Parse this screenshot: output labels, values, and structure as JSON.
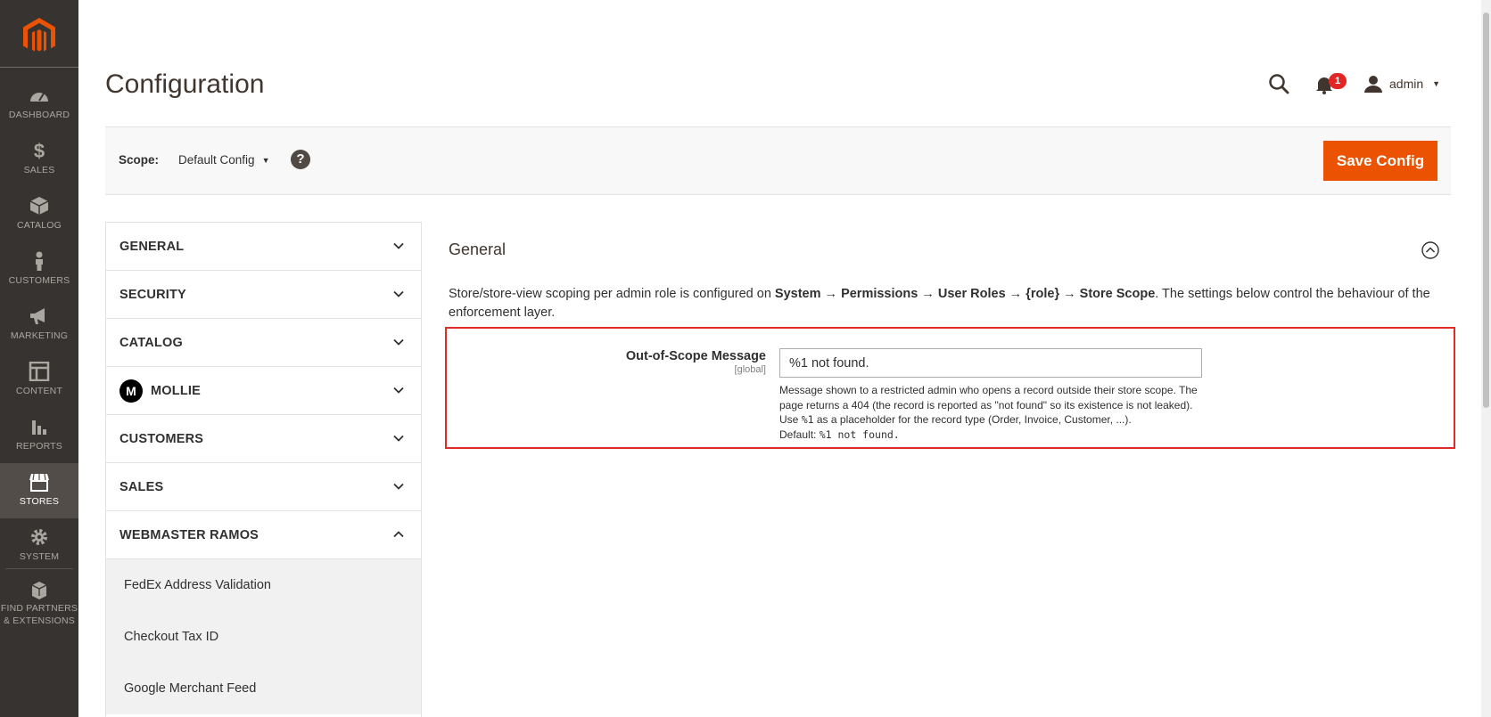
{
  "nav": {
    "items": [
      {
        "label": "DASHBOARD",
        "icon": "dashboard-icon"
      },
      {
        "label": "SALES",
        "icon": "dollar-icon"
      },
      {
        "label": "CATALOG",
        "icon": "box-icon"
      },
      {
        "label": "CUSTOMERS",
        "icon": "person-icon"
      },
      {
        "label": "MARKETING",
        "icon": "megaphone-icon"
      },
      {
        "label": "CONTENT",
        "icon": "layout-icon"
      },
      {
        "label": "REPORTS",
        "icon": "bar-chart-icon"
      },
      {
        "label": "STORES",
        "icon": "store-icon"
      },
      {
        "label": "SYSTEM",
        "icon": "gear-icon"
      },
      {
        "label_line1": "FIND PARTNERS",
        "label_line2": "& EXTENSIONS",
        "icon": "cubes-icon"
      }
    ],
    "active": "STORES"
  },
  "header": {
    "title": "Configuration",
    "notification_count": "1",
    "user": "admin"
  },
  "scope": {
    "label": "Scope:",
    "value": "Default Config",
    "help": "?",
    "save_label": "Save Config"
  },
  "tabs": {
    "items": [
      {
        "label": "GENERAL"
      },
      {
        "label": "SECURITY"
      },
      {
        "label": "CATALOG"
      },
      {
        "label": "MOLLIE"
      },
      {
        "label": "CUSTOMERS"
      },
      {
        "label": "SALES"
      },
      {
        "label": "WEBMASTER RAMOS"
      }
    ],
    "sub_items": [
      "FedEx Address Validation",
      "Checkout Tax ID",
      "Google Merchant Feed"
    ]
  },
  "section": {
    "title": "General",
    "comment_pre": "Store/store-view scoping per admin role is configured on ",
    "path_system": "System",
    "path_permissions": "Permissions",
    "path_user_roles": "User Roles",
    "path_role": "{role}",
    "path_store_scope": "Store Scope",
    "arrow": "→",
    "comment_post": ". The settings below control the behaviour of the enforcement layer.",
    "field": {
      "label": "Out-of-Scope Message",
      "scope": "[global]",
      "value": "%1 not found.",
      "note_line1": "Message shown to a restricted admin who opens a record outside their store scope.",
      "note_line2": "The page returns a 404 (the record is reported as \"not found\" so its existence is not leaked). Use ",
      "note_placeholder": "%1",
      "note_line3": " as a placeholder for the record type (Order, Invoice, Customer, ...).",
      "note_default_label": "Default: ",
      "note_default_value": "%1 not found."
    }
  },
  "colors": {
    "nav_bg": "#373330",
    "nav_active": "#524d49",
    "accent": "#eb5202",
    "error_border": "#e02b27",
    "badge": "#e22626"
  }
}
